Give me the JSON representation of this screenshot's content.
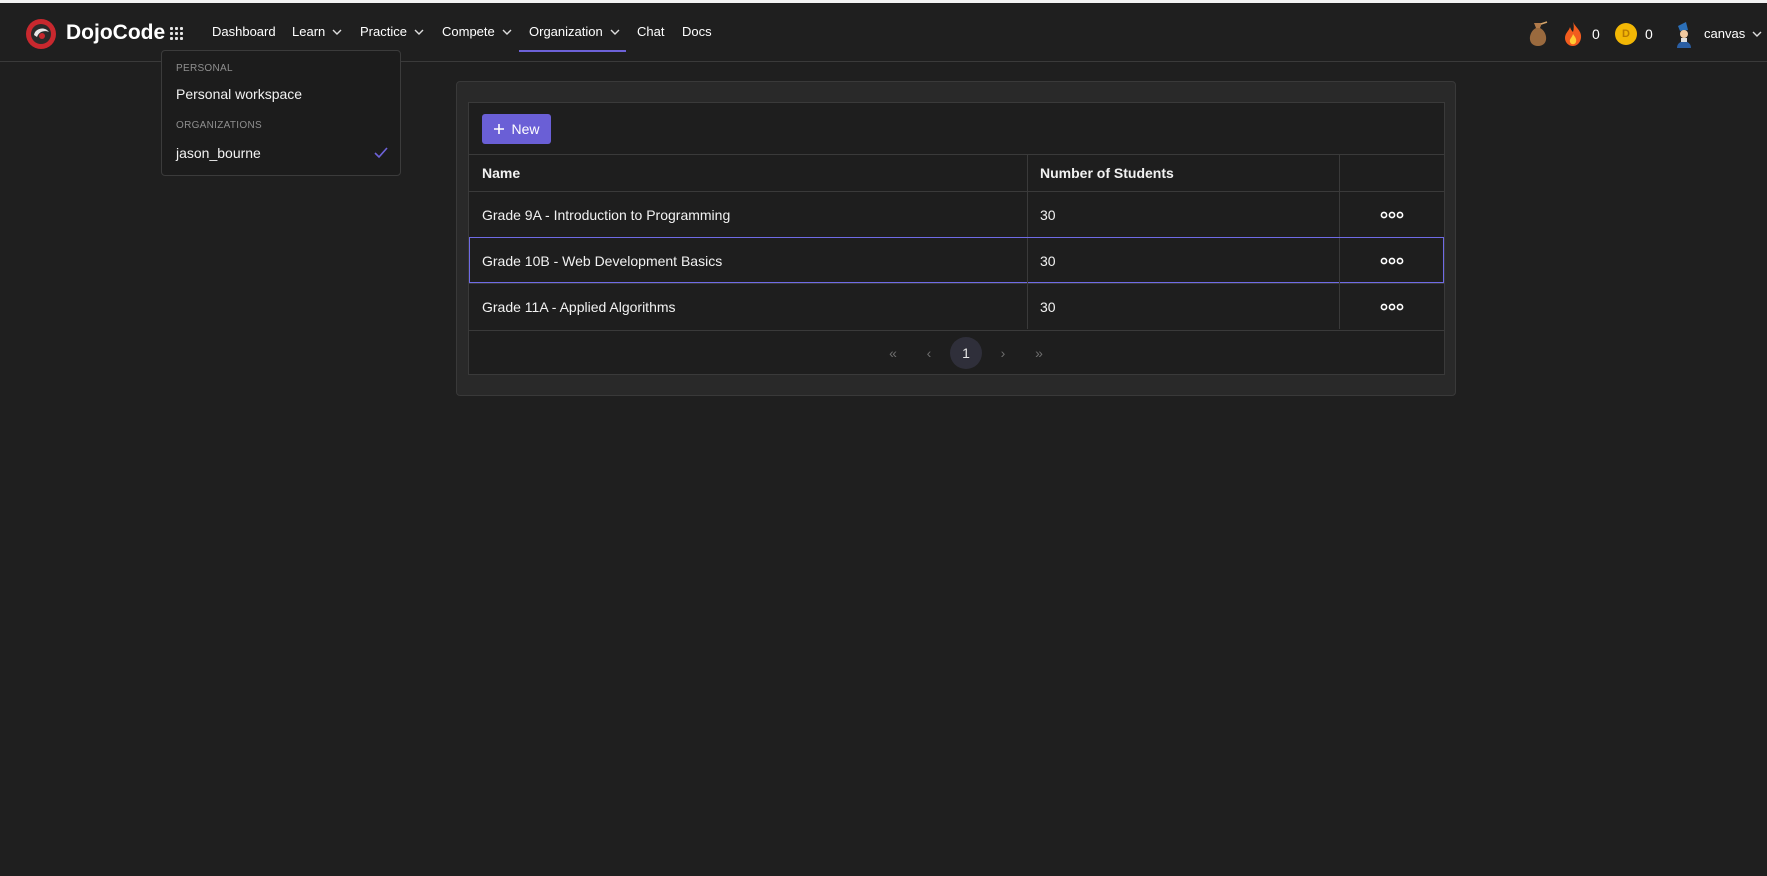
{
  "brand": {
    "name": "DojoCode"
  },
  "nav": {
    "dashboard": "Dashboard",
    "learn": "Learn",
    "practice": "Practice",
    "compete": "Compete",
    "organization": "Organization",
    "chat": "Chat",
    "docs": "Docs"
  },
  "stats": {
    "streak": "0",
    "coins": "0",
    "coin_letter": "D"
  },
  "user": {
    "name": "canvas"
  },
  "org_dropdown": {
    "personal_section": "PERSONAL",
    "personal_item": "Personal workspace",
    "orgs_section": "ORGANIZATIONS",
    "org_item": "jason_bourne"
  },
  "toolbar": {
    "new_label": "New"
  },
  "table": {
    "columns": [
      "Name",
      "Number of Students"
    ],
    "rows": [
      {
        "name": "Grade 9A - Introduction to Programming",
        "students": "30"
      },
      {
        "name": "Grade 10B - Web Development Basics",
        "students": "30"
      },
      {
        "name": "Grade 11A - Applied Algorithms",
        "students": "30"
      }
    ]
  },
  "pagination": {
    "first": "«",
    "prev": "‹",
    "current": "1",
    "next": "›",
    "last": "»"
  },
  "colors": {
    "accent": "#6a5fd6",
    "background": "#1f1f1f",
    "coin": "#f2b705"
  }
}
